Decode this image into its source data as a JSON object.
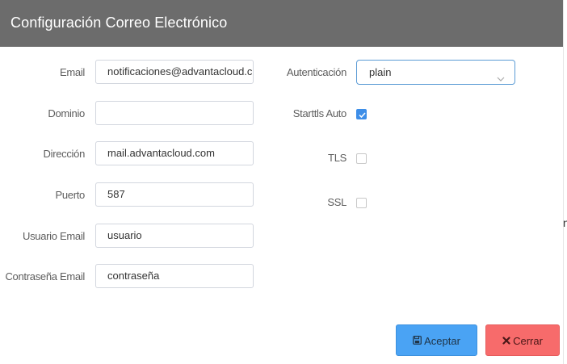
{
  "dialog": {
    "title": "Configuración Correo Electrónico"
  },
  "fields": {
    "email": {
      "label": "Email",
      "value": "notificaciones@advantacloud.c"
    },
    "dominio": {
      "label": "Dominio",
      "value": ""
    },
    "direccion": {
      "label": "Dirección",
      "value": "mail.advantacloud.com"
    },
    "puerto": {
      "label": "Puerto",
      "value": "587"
    },
    "usuario": {
      "label": "Usuario Email",
      "value": "usuario"
    },
    "contrasena": {
      "label": "Contraseña Email",
      "value": "contraseña"
    }
  },
  "options": {
    "autenticacion": {
      "label": "Autenticación",
      "selected": "plain"
    },
    "starttls": {
      "label": "Starttls Auto",
      "checked": true
    },
    "tls": {
      "label": "TLS",
      "checked": false
    },
    "ssl": {
      "label": "SSL",
      "checked": false
    }
  },
  "buttons": {
    "accept": {
      "label": "Aceptar",
      "icon": "save-icon"
    },
    "close": {
      "label": "Cerrar",
      "icon": "close-icon"
    }
  },
  "edge_text": "n",
  "colors": {
    "header": "#6c6c6c",
    "accept": "#4aa3f4",
    "close": "#f76b6b",
    "check": "#3d8ee8"
  }
}
